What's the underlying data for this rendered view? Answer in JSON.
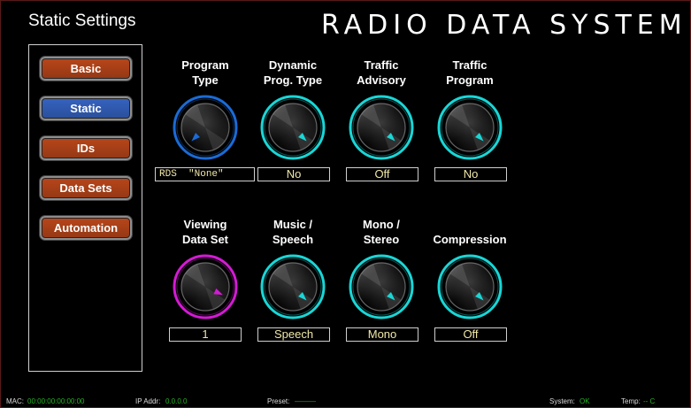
{
  "page_title": "Static Settings",
  "system_title": "RADIO DATA SYSTEM",
  "nav": {
    "items": [
      {
        "label": "Basic",
        "color": "#b8461a"
      },
      {
        "label": "Static",
        "color": "#3563c0",
        "active": true
      },
      {
        "label": "IDs",
        "color": "#b8461a"
      },
      {
        "label": "Data Sets",
        "color": "#b8461a"
      },
      {
        "label": "Automation",
        "color": "#b8461a"
      }
    ]
  },
  "knobs": {
    "program_type": {
      "label_1": "Program",
      "label_2": "Type",
      "value_prefix": "RDS",
      "value": "\"None\"",
      "ring_color": "#1a6bd6"
    },
    "dynamic_prog_type": {
      "label_1": "Dynamic",
      "label_2": "Prog. Type",
      "value": "No",
      "ring_color": "#19d6d6"
    },
    "traffic_advisory": {
      "label_1": "Traffic",
      "label_2": "Advisory",
      "value": "Off",
      "ring_color": "#19d6d6"
    },
    "traffic_program": {
      "label_1": "Traffic",
      "label_2": "Program",
      "value": "No",
      "ring_color": "#19d6d6"
    },
    "viewing_data_set": {
      "label_1": "Viewing",
      "label_2": "Data Set",
      "value": "1",
      "ring_color": "#d41ad4"
    },
    "music_speech": {
      "label_1": "Music /",
      "label_2": "Speech",
      "value": "Speech",
      "ring_color": "#19d6d6"
    },
    "mono_stereo": {
      "label_1": "Mono /",
      "label_2": "Stereo",
      "value": "Mono",
      "ring_color": "#19d6d6"
    },
    "compression": {
      "label_1": "",
      "label_2": "Compression",
      "value": "Off",
      "ring_color": "#19d6d6"
    }
  },
  "status": {
    "mac_label": "MAC:",
    "mac_value": "00:00:00:00:00:00",
    "ip_label": "IP Addr:",
    "ip_value": "0.0.0.0",
    "preset_label": "Preset:",
    "preset_value": "———",
    "system_label": "System:",
    "system_value": "OK",
    "temp_label": "Temp:",
    "temp_value": "-- C"
  }
}
